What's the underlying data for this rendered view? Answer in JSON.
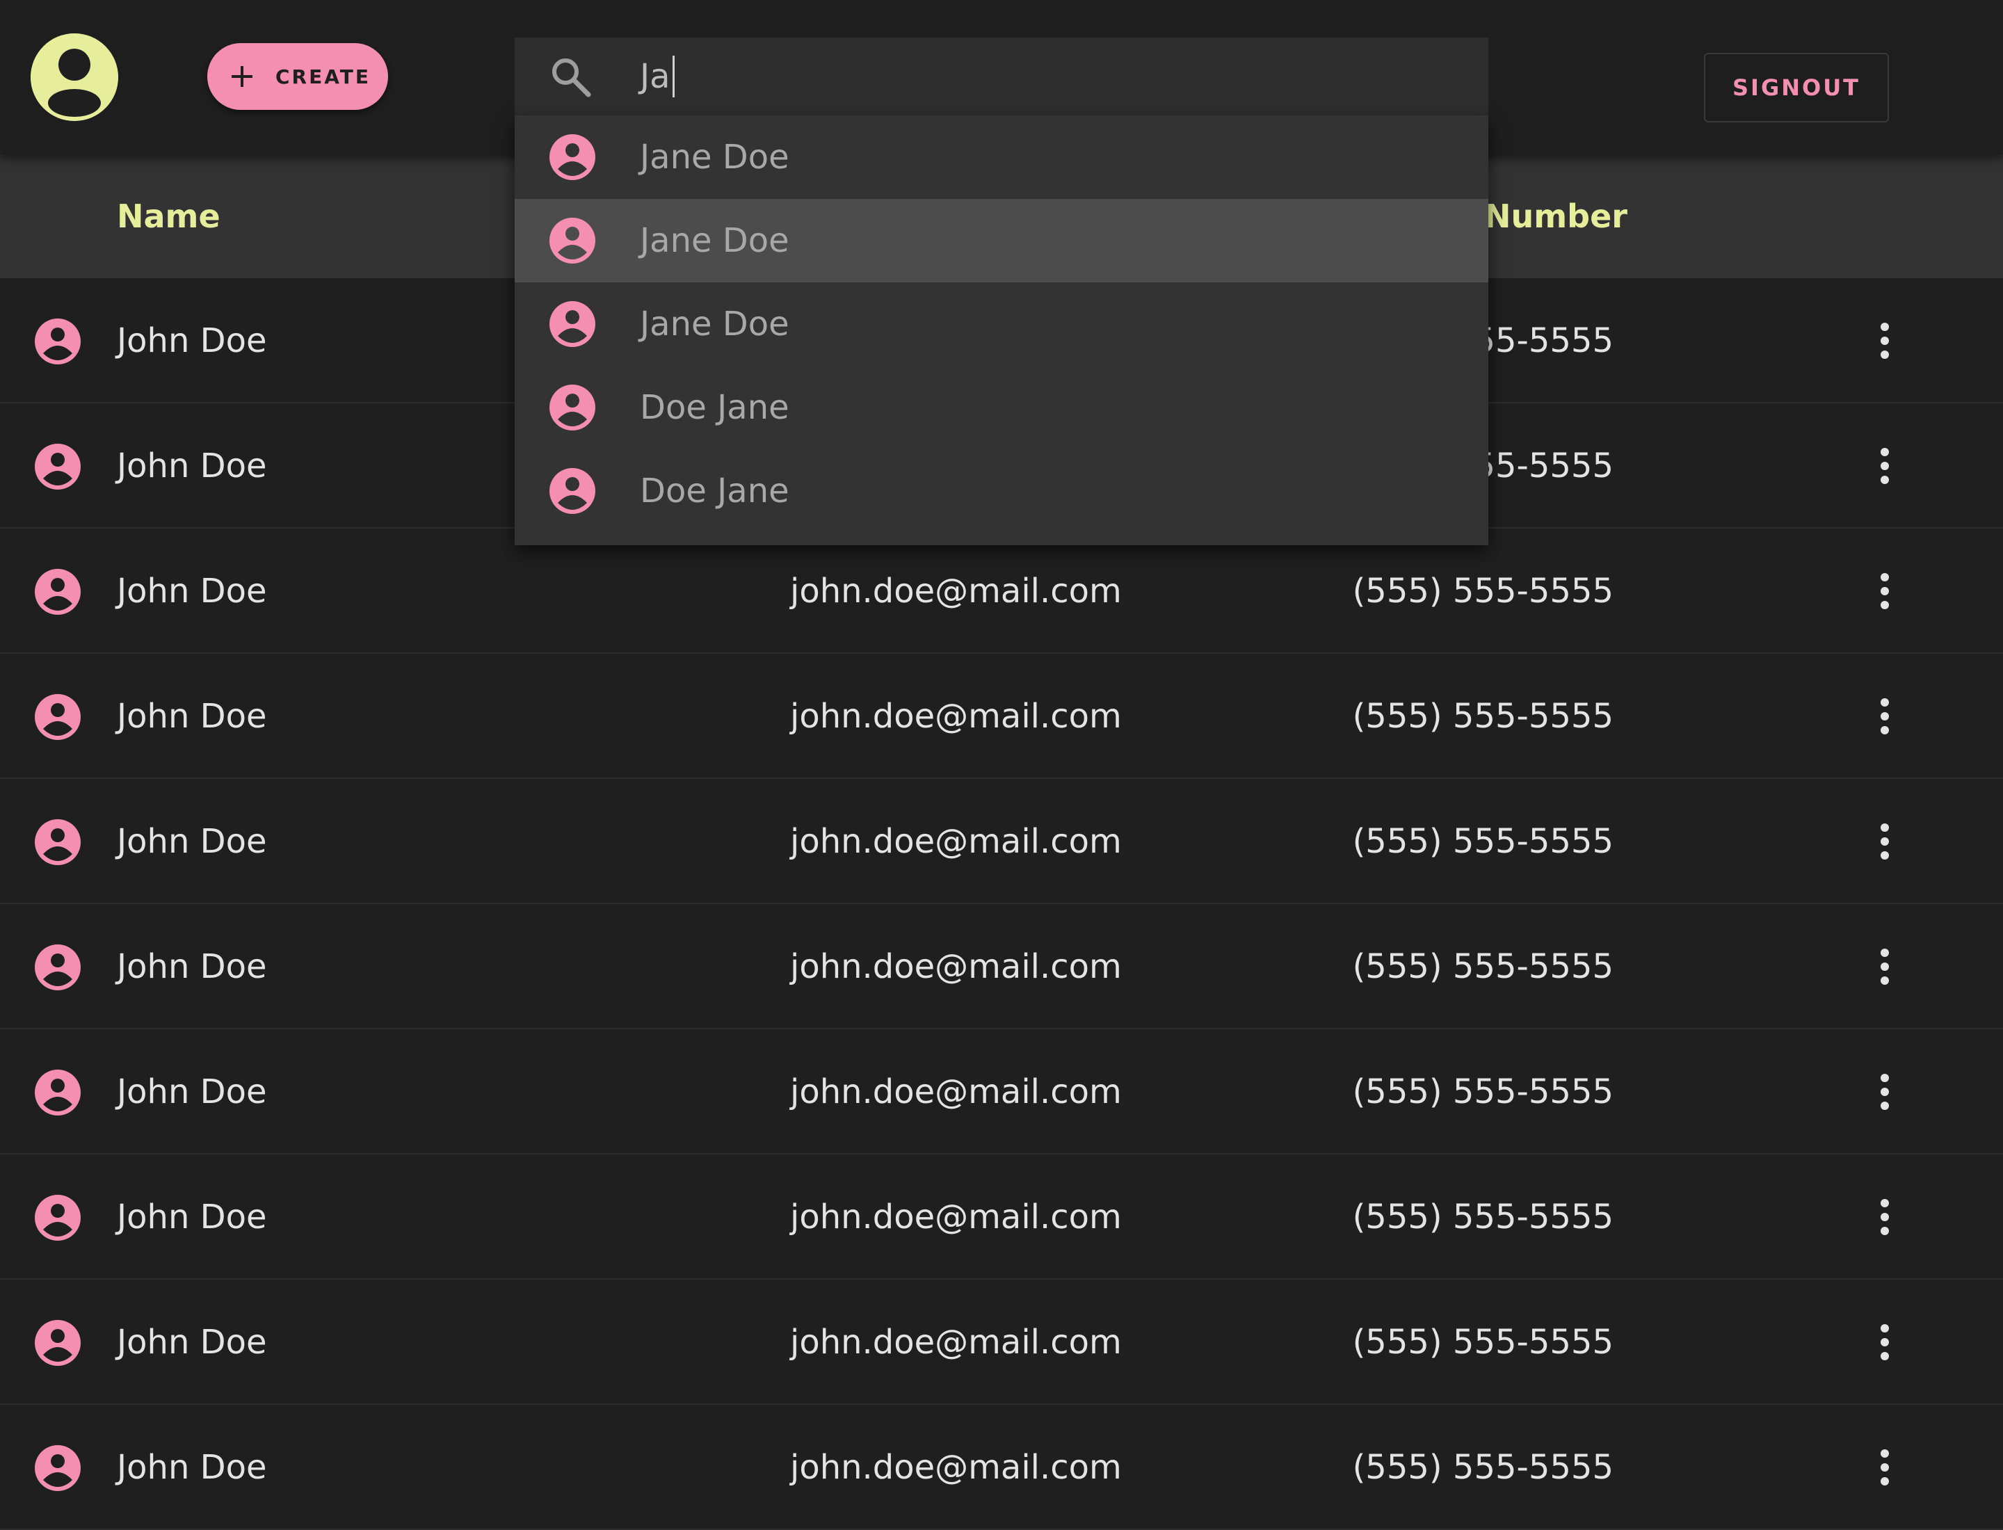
{
  "colors": {
    "accent_pink": "#f48fb1",
    "accent_lime": "#e6ee9c",
    "background": "#1f1f1f"
  },
  "header": {
    "avatar_icon": "account-circle-icon",
    "create_label": "CREATE",
    "signout_label": "SIGNOUT"
  },
  "search": {
    "icon": "search-icon",
    "query": "Ja",
    "suggestions": [
      {
        "label": "Jane Doe",
        "icon": "account-circle-icon",
        "highlighted": false
      },
      {
        "label": "Jane Doe",
        "icon": "account-circle-icon",
        "highlighted": true
      },
      {
        "label": "Jane Doe",
        "icon": "account-circle-icon",
        "highlighted": false
      },
      {
        "label": "Doe Jane",
        "icon": "account-circle-icon",
        "highlighted": false
      },
      {
        "label": "Doe Jane",
        "icon": "account-circle-icon",
        "highlighted": false
      }
    ]
  },
  "table": {
    "columns": [
      {
        "label": "Name"
      },
      {
        "label": "Number"
      }
    ],
    "rows": [
      {
        "name": "John Doe",
        "email": "",
        "phone": "55-5555"
      },
      {
        "name": "John Doe",
        "email": "",
        "phone": "55-5555"
      },
      {
        "name": "John Doe",
        "email": "john.doe@mail.com",
        "phone": "(555) 555-5555"
      },
      {
        "name": "John Doe",
        "email": "john.doe@mail.com",
        "phone": "(555) 555-5555"
      },
      {
        "name": "John Doe",
        "email": "john.doe@mail.com",
        "phone": "(555) 555-5555"
      },
      {
        "name": "John Doe",
        "email": "john.doe@mail.com",
        "phone": "(555) 555-5555"
      },
      {
        "name": "John Doe",
        "email": "john.doe@mail.com",
        "phone": "(555) 555-5555"
      },
      {
        "name": "John Doe",
        "email": "john.doe@mail.com",
        "phone": "(555) 555-5555"
      },
      {
        "name": "John Doe",
        "email": "john.doe@mail.com",
        "phone": "(555) 555-5555"
      },
      {
        "name": "John Doe",
        "email": "john.doe@mail.com",
        "phone": "(555) 555-5555"
      }
    ],
    "row_icon": "account-circle-icon",
    "row_action_icon": "more-vert-icon"
  }
}
